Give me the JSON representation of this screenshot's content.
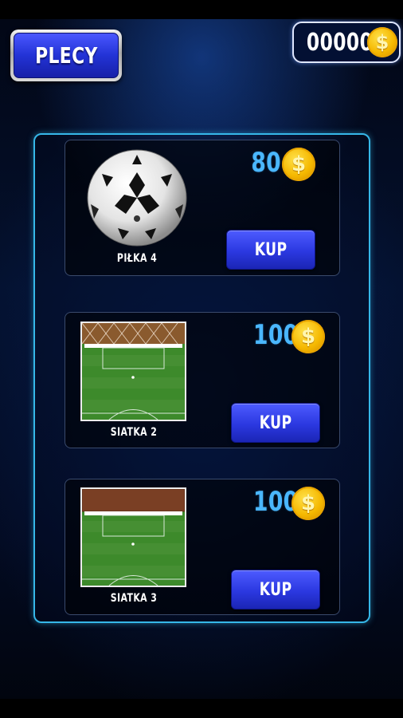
{
  "header": {
    "back_label": "PLECY",
    "coin_balance": "00000",
    "coin_symbol": "$"
  },
  "shop": {
    "items": [
      {
        "label": "PIŁKA 4",
        "price": "80",
        "buy_label": "KUP",
        "preview": "soccer-ball"
      },
      {
        "label": "SIATKA 2",
        "price": "100",
        "buy_label": "KUP",
        "preview": "goal-net-pitch"
      },
      {
        "label": "SIATKA 3",
        "price": "100",
        "buy_label": "KUP",
        "preview": "goal-net-pitch"
      }
    ]
  },
  "colors": {
    "accent_blue": "#2b38e0",
    "price_blue": "#4ab7ff",
    "panel_border": "#36b7e8",
    "coin_gold": "#f5b800"
  }
}
